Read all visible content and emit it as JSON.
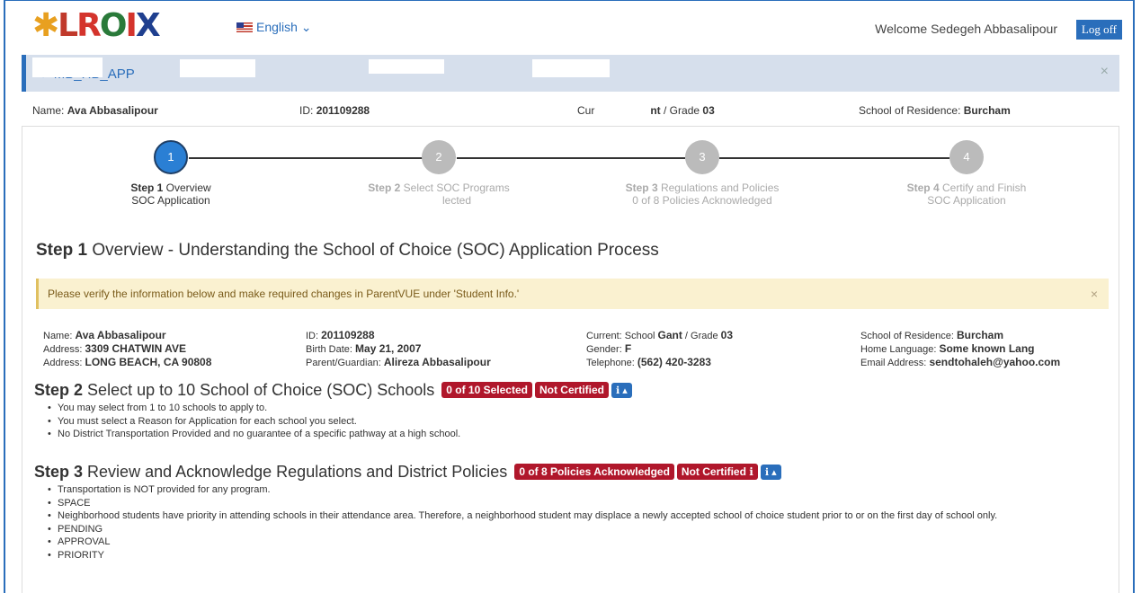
{
  "header": {
    "logo_text": "LROIX",
    "language_label": "English ⌄",
    "welcome_text": "Welcome Sedegeh Abbasalipour",
    "logoff_label": "Log off"
  },
  "app_bar": {
    "app_name": "⟳ MB_HB_APP",
    "close_icon": "×"
  },
  "student_summary": {
    "name_label": "Name:",
    "name_value": "Ava Abbasalipour",
    "id_label": "ID:",
    "id_value": "201109288",
    "current_label": "Cur",
    "current_value": "nt",
    "grade_label": "/ Grade",
    "grade_value": "03",
    "residence_label": "School of Residence:",
    "residence_value": "Burcham"
  },
  "steps": [
    {
      "number": "1",
      "title": "Step 1",
      "line1": "Overview",
      "line2": "SOC Application",
      "state": "active"
    },
    {
      "number": "2",
      "title": "Step 2",
      "line1": "Select SOC Programs",
      "line2": "lected",
      "state": "inactive"
    },
    {
      "number": "3",
      "title": "Step 3",
      "line1": "Regulations and Policies",
      "line2": "0 of 8 Policies Acknowledged",
      "state": "inactive"
    },
    {
      "number": "4",
      "title": "Step 4",
      "line1": "Certify and Finish",
      "line2": "SOC Application",
      "state": "inactive"
    }
  ],
  "step1_heading": {
    "bold": "Step 1",
    "text": "Overview - Understanding the School of Choice (SOC) Application Process"
  },
  "alert": {
    "text": "Please verify the information below and make required changes in ParentVUE under 'Student Info.'",
    "close_icon": "×"
  },
  "details": {
    "col1": [
      {
        "label": "Name:",
        "value": "Ava Abbasalipour"
      },
      {
        "label": "Address:",
        "value": "3309 CHATWIN AVE"
      },
      {
        "label": "Address:",
        "value": "LONG BEACH, CA 90808"
      }
    ],
    "col2": [
      {
        "label": "ID:",
        "value": "201109288"
      },
      {
        "label": "Birth Date:",
        "value": "May 21, 2007"
      },
      {
        "label": "Parent/Guardian:",
        "value": "Alireza Abbasalipour"
      }
    ],
    "col3": [
      {
        "label": "Current: School",
        "value": "Gant",
        "suffix_label": "/ Grade",
        "suffix_value": "03"
      },
      {
        "label": "Gender:",
        "value": "F"
      },
      {
        "label": "Telephone:",
        "value": "(562) 420-3283"
      }
    ],
    "col4": [
      {
        "label": "School of Residence:",
        "value": "Burcham"
      },
      {
        "label": "Home Language:",
        "value": "Some known Lang"
      },
      {
        "label": "Email Address:",
        "value": "sendtohaleh@yahoo.com"
      }
    ]
  },
  "step2": {
    "bold": "Step 2",
    "text": "Select up to 10 School of Choice (SOC) Schools",
    "badge_selected": "0 of 10 Selected",
    "badge_cert": "Not Certified",
    "info_button": "ℹ ▴",
    "bullets": [
      "You may select from 1 to 10 schools to apply to.",
      "You must select a Reason for Application for each school you select.",
      "No District Transportation Provided and no guarantee of a specific pathway at a high school."
    ]
  },
  "step3": {
    "bold": "Step 3",
    "text": "Review and Acknowledge Regulations and District Policies",
    "badge_ack": "0 of 8 Policies Acknowledged",
    "badge_cert": "Not Certified ℹ",
    "info_button": "ℹ ▴",
    "bullets": [
      "Transportation is NOT provided for any program.",
      "SPACE",
      "Neighborhood students have priority in attending schools in their attendance area. Therefore, a neighborhood student may displace a newly accepted school of choice student prior to or on the first day of school only.",
      "PENDING",
      "APPROVAL",
      "PRIORITY"
    ]
  }
}
